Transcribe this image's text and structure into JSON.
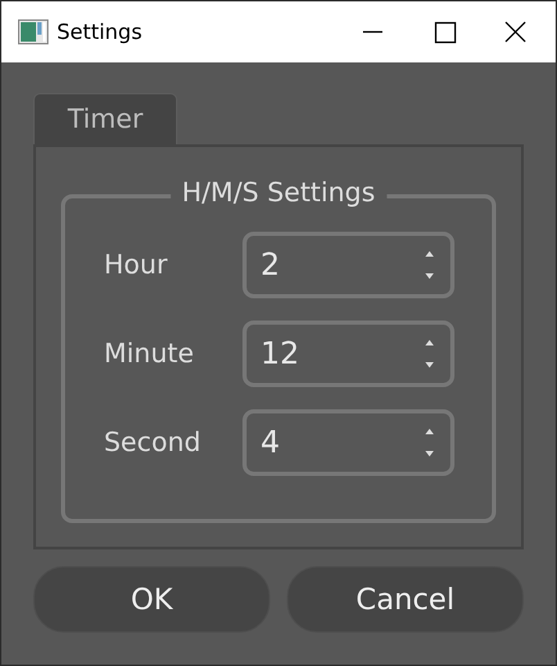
{
  "window": {
    "title": "Settings"
  },
  "tabs": [
    {
      "label": "Timer",
      "selected": true
    }
  ],
  "group": {
    "title": "H/M/S Settings"
  },
  "fields": [
    {
      "label": "Hour",
      "value": "2"
    },
    {
      "label": "Minute",
      "value": "12"
    },
    {
      "label": "Second",
      "value": "4"
    }
  ],
  "buttons": [
    "OK",
    "Cancel"
  ]
}
